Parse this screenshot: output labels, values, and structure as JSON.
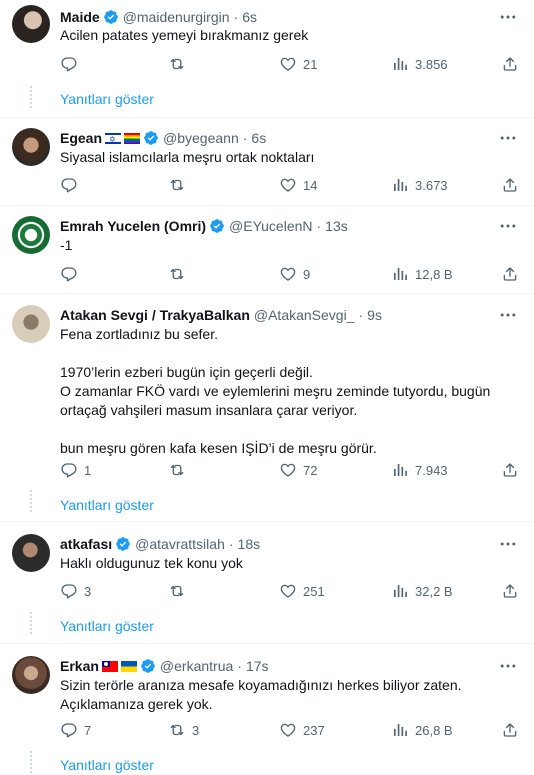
{
  "tweets": [
    {
      "name": "Maide",
      "handle": "@maidenurgirgin",
      "time": "6s",
      "text": [
        "Acilen patates yemeyi bırakmanız gerek"
      ],
      "replies": "",
      "retweets": "",
      "likes": "21",
      "views": "3.856",
      "show_replies": "Yanıtları göster"
    },
    {
      "name": "Egean",
      "handle": "@byegeann",
      "time": "6s",
      "text": [
        "Siyasal islamcılarla meşru ortak noktaları"
      ],
      "replies": "",
      "retweets": "",
      "likes": "14",
      "views": "3.673",
      "show_replies": ""
    },
    {
      "name": "Emrah Yucelen (Omri)",
      "handle": "@EYucelenN",
      "time": "13s",
      "text": [
        "-1"
      ],
      "replies": "",
      "retweets": "",
      "likes": "9",
      "views": "12,8 B",
      "show_replies": ""
    },
    {
      "name": "Atakan Sevgi / TrakyaBalkan",
      "handle": "@AtakanSevgi_",
      "time": "9s",
      "text": [
        "Fena zortladınız bu sefer.",
        "",
        "1970’lerin ezberi bugün için geçerli değil.",
        "O zamanlar FKÖ vardı ve eylemlerini meşru zeminde tutyordu, bugün ortaçağ vahşileri masum insanlara çarar veriyor.",
        "",
        "bun meşru gören kafa kesen IŞİD’i de meşru görür."
      ],
      "replies": "1",
      "retweets": "",
      "likes": "72",
      "views": "7.943",
      "show_replies": "Yanıtları göster"
    },
    {
      "name": "atkafası",
      "handle": "@atavrattsilah",
      "time": "18s",
      "text": [
        "Haklı oldugunuz tek konu yok"
      ],
      "replies": "3",
      "retweets": "",
      "likes": "251",
      "views": "32,2 B",
      "show_replies": "Yanıtları göster"
    },
    {
      "name": "Erkan",
      "handle": "@erkantrua",
      "time": "17s",
      "text": [
        "Sizin terörle aranıza mesafe koyamadığınızı herkes biliyor zaten.",
        "Açıklamanıza gerek yok."
      ],
      "replies": "7",
      "retweets": "3",
      "likes": "237",
      "views": "26,8 B",
      "show_replies": "Yanıtları göster"
    }
  ],
  "colors": {
    "verified": "#1d9bf0",
    "secondary": "#536471",
    "link": "#1d9bf0",
    "border": "#eff3f4"
  },
  "icons": [
    "verified-badge-icon",
    "more-icon",
    "reply-icon",
    "retweet-icon",
    "like-icon",
    "views-icon",
    "share-icon"
  ]
}
